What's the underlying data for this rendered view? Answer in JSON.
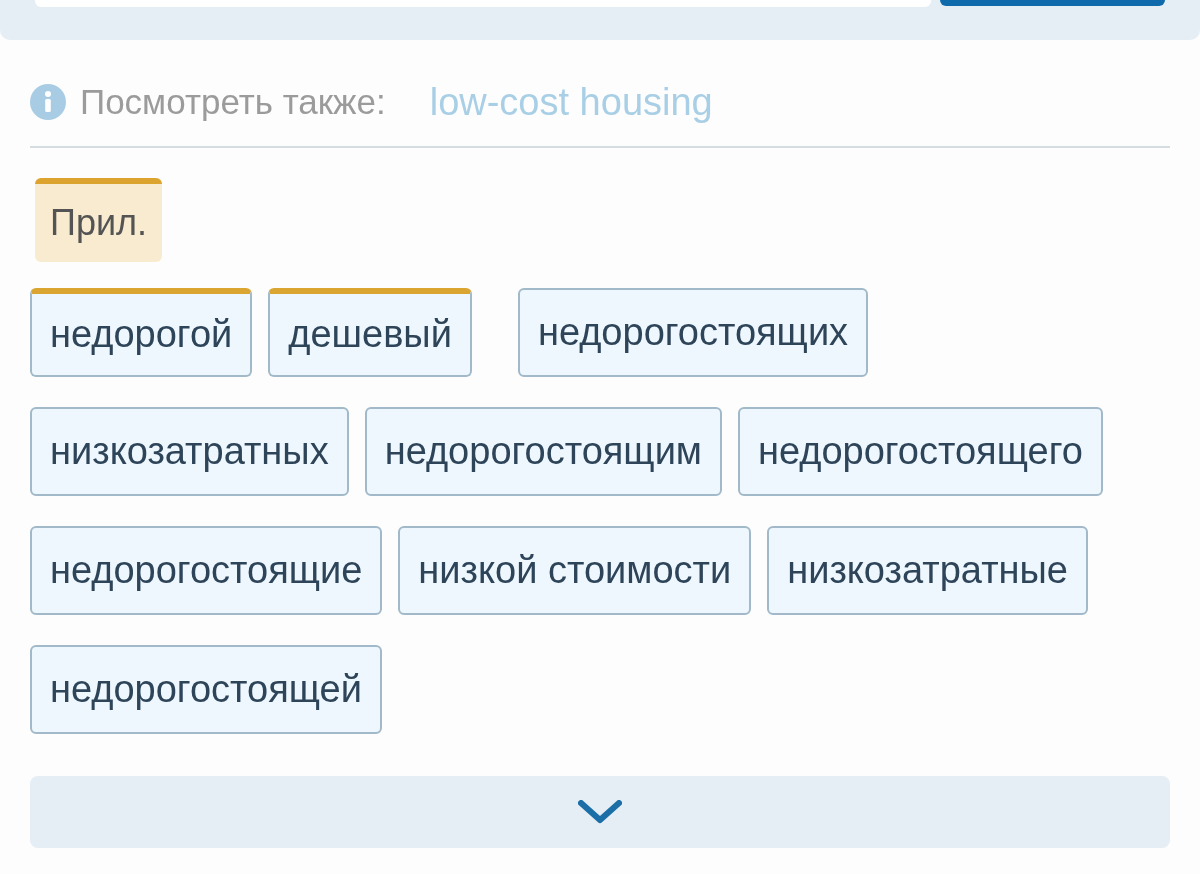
{
  "see_also": {
    "label": "Посмотреть также:",
    "link": "low-cost housing"
  },
  "part_of_speech": "Прил.",
  "translations": [
    {
      "text": "недорогой",
      "frequent": true
    },
    {
      "text": "дешевый",
      "frequent": true
    },
    {
      "text": "недорогостоящих",
      "frequent": false
    },
    {
      "text": "низкозатратных",
      "frequent": false
    },
    {
      "text": "недорогостоящим",
      "frequent": false
    },
    {
      "text": "недорогостоящего",
      "frequent": false
    },
    {
      "text": "недорогостоящие",
      "frequent": false
    },
    {
      "text": "низкой стоимости",
      "frequent": false
    },
    {
      "text": "низкозатратные",
      "frequent": false
    },
    {
      "text": "недорогостоящей",
      "frequent": false
    }
  ]
}
